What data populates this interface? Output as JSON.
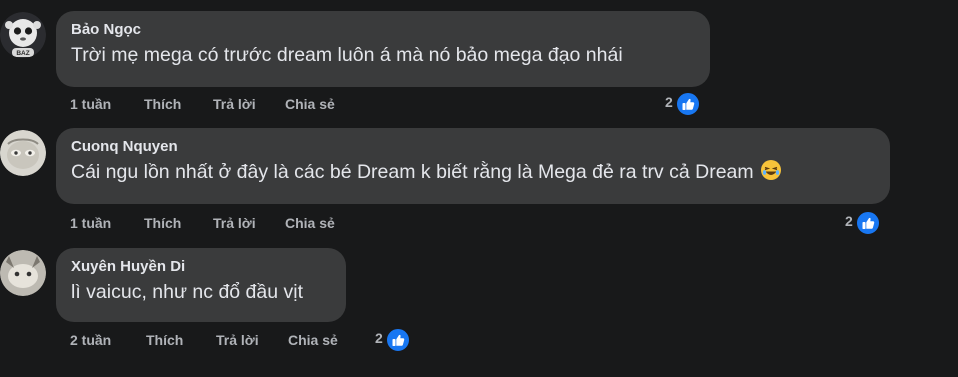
{
  "comments": [
    {
      "author": "Bảo Ngọc",
      "text": "Trời mẹ mega có trước dream luôn á mà nó bảo mega đạo nhái",
      "time": "1 tuần",
      "like_label": "Thích",
      "reply_label": "Trả lời",
      "share_label": "Chia sẻ",
      "reaction_count": "2",
      "avatar_badge": "BAZ"
    },
    {
      "author": "Cuonq Nquyen",
      "text": "Cái ngu lồn nhất ở đây là các bé Dream k biết rằng là Mega đẻ ra trv cả Dream",
      "time": "1 tuần",
      "like_label": "Thích",
      "reply_label": "Trả lời",
      "share_label": "Chia sẻ",
      "reaction_count": "2",
      "emoji": "laughing-emoji"
    },
    {
      "author": "Xuyên Huyền Di",
      "text": "lì vaicuc, như nc đổ đầu vịt",
      "time": "2 tuần",
      "like_label": "Thích",
      "reply_label": "Trả lời",
      "share_label": "Chia sẻ",
      "reaction_count": "2"
    }
  ],
  "colors": {
    "background": "#18191a",
    "bubble": "#3a3b3c",
    "text": "#e4e6eb",
    "secondary_text": "#b0b3b8",
    "like_blue": "#1877f2"
  }
}
